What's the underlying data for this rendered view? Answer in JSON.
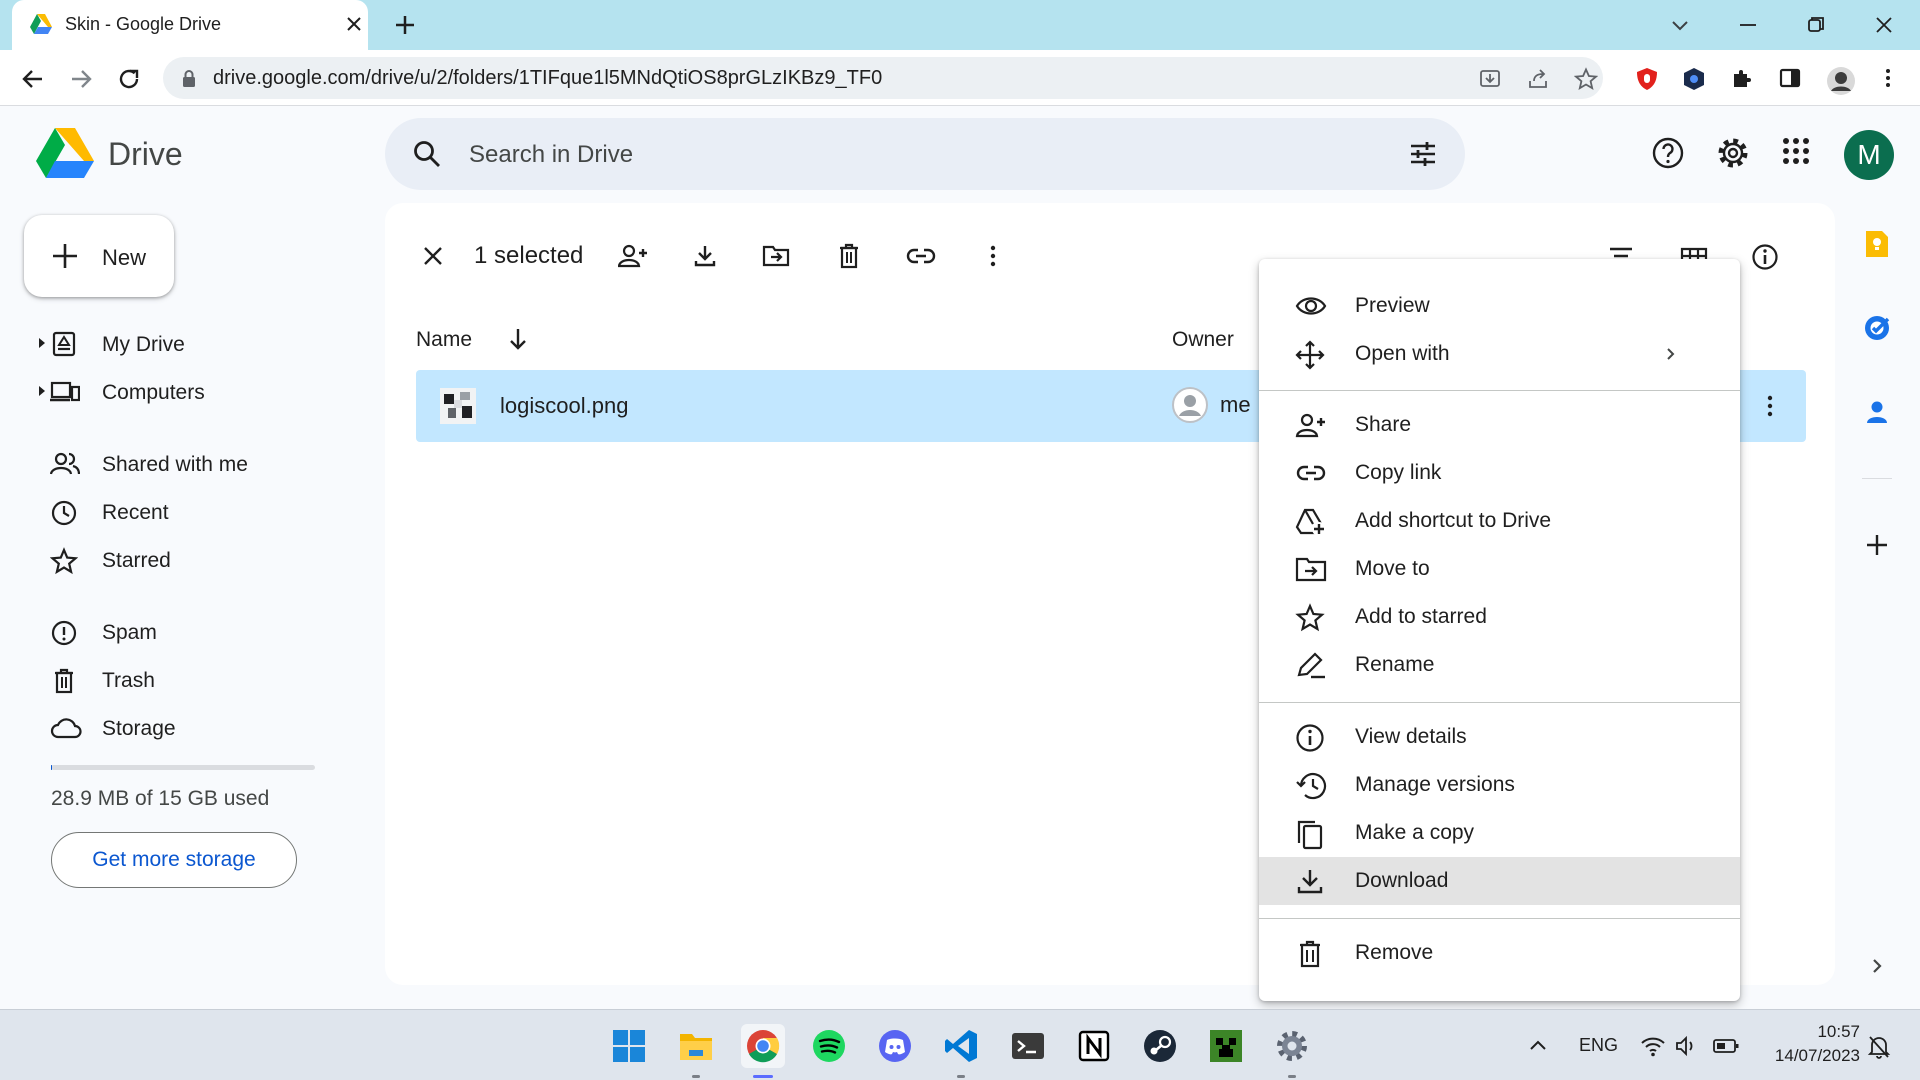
{
  "browser": {
    "tab_title": "Skin - Google Drive",
    "url": "drive.google.com/drive/u/2/folders/1TIFque1l5MNdQtiOS8prGLzIKBz9_TF0"
  },
  "app": {
    "product_name": "Drive",
    "search_placeholder": "Search in Drive",
    "account_initial": "M",
    "new_button": "New"
  },
  "sidebar": {
    "items": [
      {
        "label": "My Drive",
        "icon": "my-drive-icon"
      },
      {
        "label": "Computers",
        "icon": "computers-icon"
      },
      {
        "label": "Shared with me",
        "icon": "shared-icon"
      },
      {
        "label": "Recent",
        "icon": "clock-icon"
      },
      {
        "label": "Starred",
        "icon": "star-icon"
      },
      {
        "label": "Spam",
        "icon": "spam-icon"
      },
      {
        "label": "Trash",
        "icon": "trash-icon"
      },
      {
        "label": "Storage",
        "icon": "cloud-icon"
      }
    ],
    "storage_text": "28.9 MB of 15 GB used",
    "storage_used_fraction": 0.002,
    "more_storage_button": "Get more storage"
  },
  "selection_bar": {
    "count_text": "1 selected"
  },
  "file_list": {
    "columns": [
      "Name",
      "Owner"
    ],
    "rows": [
      {
        "name": "logiscool.png",
        "owner": "me"
      }
    ]
  },
  "context_menu": {
    "groups": [
      [
        {
          "label": "Preview",
          "icon": "eye-icon"
        },
        {
          "label": "Open with",
          "icon": "open-with-icon",
          "submenu": true
        }
      ],
      [
        {
          "label": "Share",
          "icon": "share-person-icon"
        },
        {
          "label": "Copy link",
          "icon": "link-icon"
        },
        {
          "label": "Add shortcut to Drive",
          "icon": "add-shortcut-icon"
        },
        {
          "label": "Move to",
          "icon": "move-to-icon"
        },
        {
          "label": "Add to starred",
          "icon": "star-icon"
        },
        {
          "label": "Rename",
          "icon": "rename-icon"
        }
      ],
      [
        {
          "label": "View details",
          "icon": "info-icon"
        },
        {
          "label": "Manage versions",
          "icon": "history-icon"
        },
        {
          "label": "Make a copy",
          "icon": "copy-icon"
        },
        {
          "label": "Download",
          "icon": "download-icon",
          "highlighted": true
        }
      ],
      [
        {
          "label": "Remove",
          "icon": "trash-icon"
        }
      ]
    ]
  },
  "taskbar": {
    "apps": [
      "windows-start",
      "file-explorer",
      "chrome",
      "spotify",
      "discord",
      "vscode",
      "terminal",
      "notion",
      "steam",
      "minecraft",
      "settings"
    ],
    "language": "ENG",
    "time": "10:57",
    "date": "14/07/2023"
  },
  "colors": {
    "selection": "#c2e7ff",
    "accent": "#0b57d0",
    "tab_strip": "#b5e3ef",
    "avatar": "#0b6e4f"
  }
}
